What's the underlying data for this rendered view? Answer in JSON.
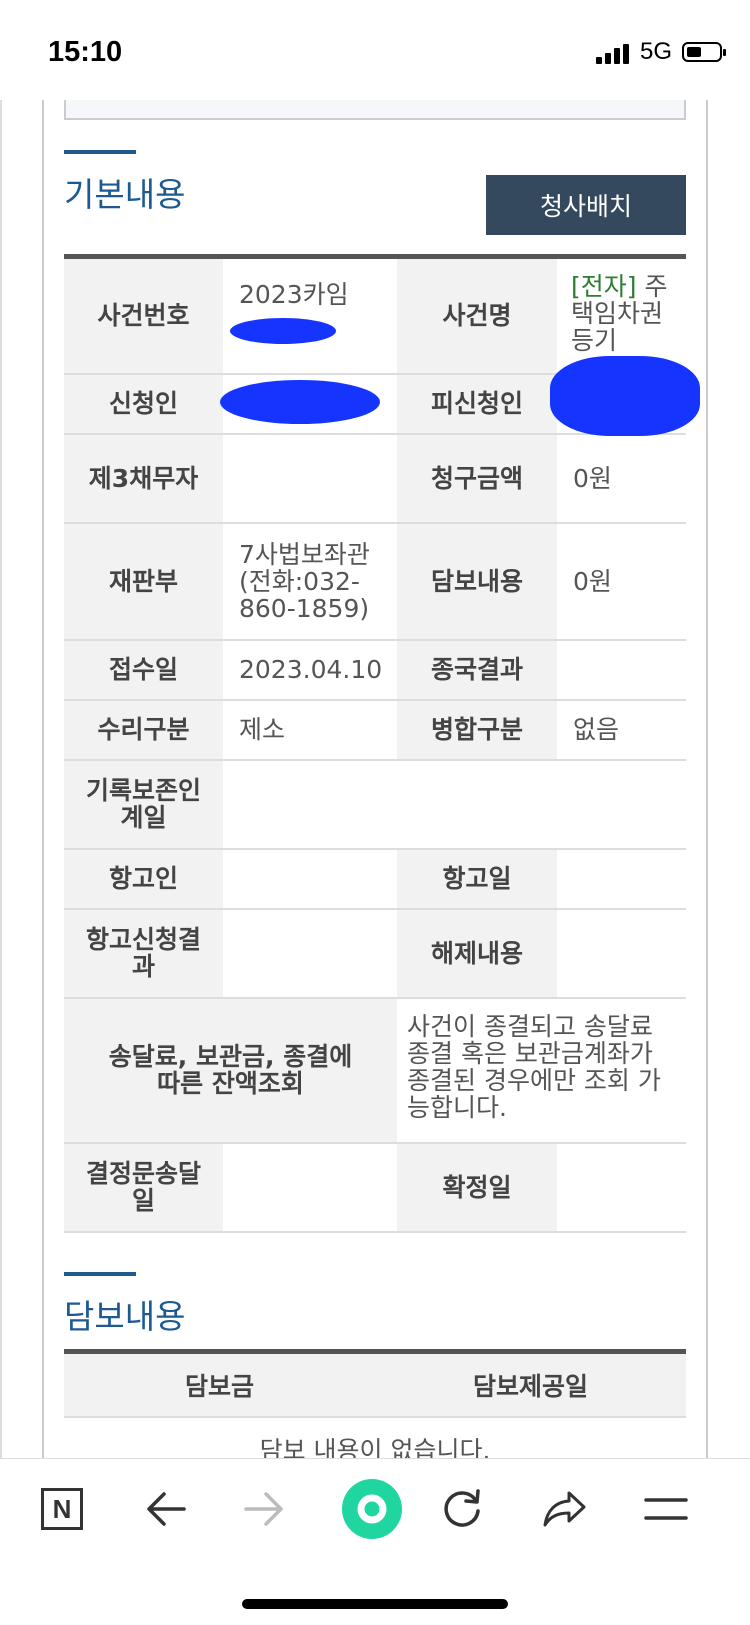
{
  "status_bar": {
    "time": "15:10",
    "network": "5G"
  },
  "basic_section": {
    "title": "기본내용",
    "seat_button": "청사배치",
    "rows": {
      "case_no_label": "사건번호",
      "case_no_value": "2023카임",
      "case_name_label": "사건명",
      "case_name_prefix": "[전자]",
      "case_name_value": " 주택임차권등기",
      "applicant_label": "신청인",
      "respondent_label": "피신청인",
      "third_debtor_label": "제3채무자",
      "claim_amount_label": "청구금액",
      "claim_amount_value": "0원",
      "court_label": "재판부",
      "court_value": "7사법보좌관(전화:032-860-1859)",
      "collateral_label": "담보내용",
      "collateral_value": "0원",
      "receipt_date_label": "접수일",
      "receipt_date_value": "2023.04.10",
      "final_result_label": "종국결과",
      "receipt_type_label": "수리구분",
      "receipt_type_value": "제소",
      "merge_type_label": "병합구분",
      "merge_type_value": "없음",
      "record_keep_label": "기록보존인계일",
      "appellant_label": "항고인",
      "appeal_date_label": "항고일",
      "appeal_result_label": "항고신청결과",
      "release_label": "해제내용",
      "balance_label": "송달료, 보관금, 종결에 따른 잔액조회",
      "balance_value": "사건이 종결되고 송달료 종결 혹은 보관금계좌가 종결된 경우에만 조회 가능합니다.",
      "decision_send_label": "결정문송달일",
      "confirm_date_label": "확정일"
    }
  },
  "collateral_section": {
    "title": "담보내용",
    "col_amount": "담보금",
    "col_date": "담보제공일",
    "empty_message": "담보 내용이 없습니다."
  },
  "bottom_nav": {
    "home_icon_letter": "N"
  },
  "colors": {
    "header_blue": "#1d5a92",
    "button_bg": "#34495e",
    "redaction_blue": "#1535ff",
    "electronic_tag": "#2e7d32",
    "green_button": "#20d6a0"
  }
}
